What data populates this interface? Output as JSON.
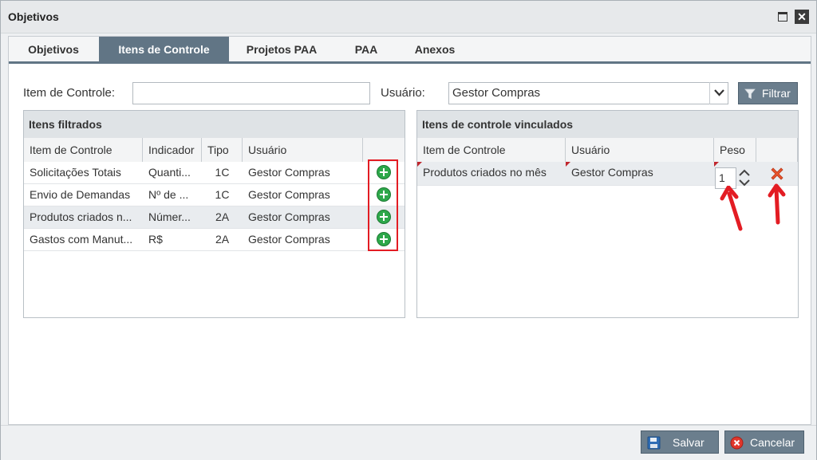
{
  "window": {
    "title": "Objetivos"
  },
  "tabs": [
    {
      "label": "Objetivos",
      "active": false
    },
    {
      "label": "Itens de Controle",
      "active": true
    },
    {
      "label": "Projetos PAA",
      "active": false
    },
    {
      "label": "PAA",
      "active": false
    },
    {
      "label": "Anexos",
      "active": false
    }
  ],
  "filter": {
    "item_label": "Item de Controle:",
    "item_value": "",
    "user_label": "Usuário:",
    "user_value": "Gestor Compras",
    "filter_button": "Filtrar"
  },
  "left_panel": {
    "title": "Itens filtrados",
    "columns": [
      "Item de Controle",
      "Indicador",
      "Tipo",
      "Usuário"
    ],
    "rows": [
      {
        "item": "Solicitações Totais",
        "indicador": "Quanti...",
        "tipo": "1C",
        "usuario": "Gestor Compras"
      },
      {
        "item": "Envio de Demandas",
        "indicador": "Nº de ...",
        "tipo": "1C",
        "usuario": "Gestor Compras"
      },
      {
        "item": "Produtos criados n...",
        "indicador": "Númer...",
        "tipo": "2A",
        "usuario": "Gestor Compras"
      },
      {
        "item": "Gastos com Manut...",
        "indicador": "R$",
        "tipo": "2A",
        "usuario": "Gestor Compras"
      }
    ]
  },
  "right_panel": {
    "title": "Itens de controle vinculados",
    "columns": [
      "Item de Controle",
      "Usuário",
      "Peso"
    ],
    "rows": [
      {
        "item": "Produtos criados no mês",
        "usuario": "Gestor Compras",
        "peso": "1"
      }
    ]
  },
  "footer": {
    "save": "Salvar",
    "cancel": "Cancelar"
  },
  "colors": {
    "tab_active": "#617585",
    "add_icon": "#2da84a",
    "highlight": "#e31c23",
    "remove_icon": "#e8542b"
  }
}
